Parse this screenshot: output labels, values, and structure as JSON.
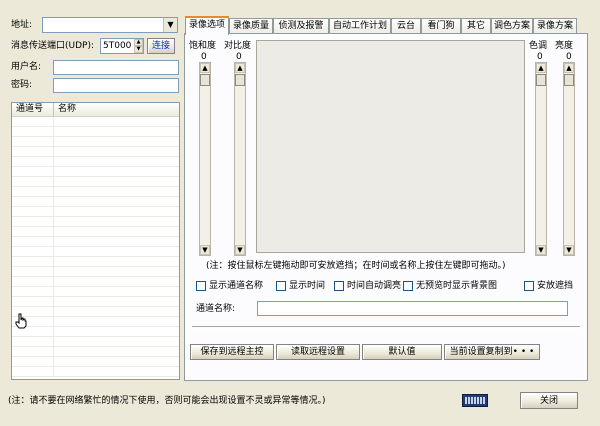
{
  "left": {
    "address_label": "地址:",
    "address_value": "",
    "port_label": "消息传送端口(UDP):",
    "port_value": "5T000",
    "connect_label": "连接",
    "username_label": "用户名:",
    "username_value": "",
    "password_label": "密码:",
    "password_value": "",
    "channel_table": {
      "columns": [
        "通道号",
        "名称"
      ]
    }
  },
  "tabs": [
    "录像选项",
    "录像质量",
    "侦测及报警",
    "自动工作计划",
    "云台",
    "看门狗",
    "其它",
    "调色方案",
    "录像方案"
  ],
  "video": {
    "saturation_label": "饱和度",
    "saturation_value": "0",
    "contrast_label": "对比度",
    "contrast_value": "0",
    "hue_label": "色调",
    "hue_value": "0",
    "brightness_label": "亮度",
    "brightness_value": "0",
    "note": "(注：按住鼠标左键拖动即可安放遮挡；在时间或名称上按住左键即可拖动。)",
    "checkboxes": [
      "显示通道名称",
      "显示时间",
      "时间自动调亮",
      "无预览时显示背景图",
      "安放遮挡"
    ],
    "channel_name_label": "通道名称:",
    "channel_name_value": ""
  },
  "actions": {
    "save_remote": "保存到远程主控",
    "read_remote": "读取远程设置",
    "default": "默认值",
    "copy_to": "当前设置复制到• • •"
  },
  "footer": {
    "note": "(注：请不要在网络繁忙的情况下使用，否则可能会出现设置不灵或异常等情况。)",
    "close": "关闭"
  }
}
